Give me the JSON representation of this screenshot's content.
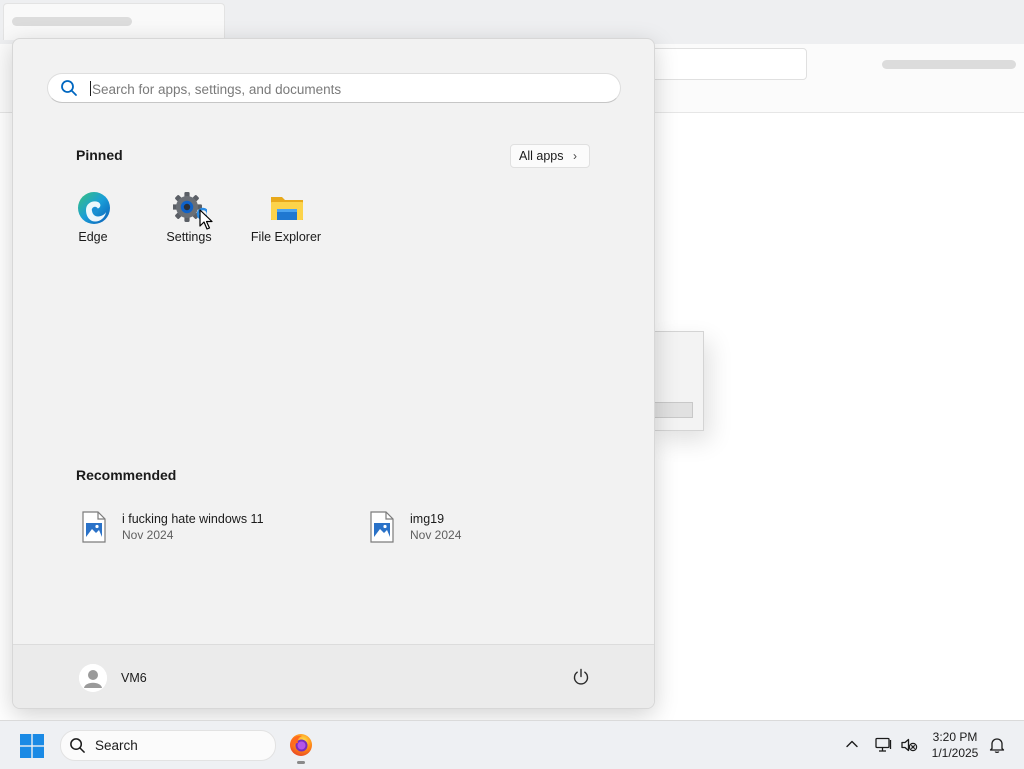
{
  "background_window": {},
  "start_menu": {
    "search": {
      "placeholder": "Search for apps, settings, and documents",
      "icon": "search-icon"
    },
    "pinned": {
      "title": "Pinned",
      "all_apps_label": "All apps",
      "apps": [
        {
          "label": "Edge",
          "icon": "edge-icon"
        },
        {
          "label": "Settings",
          "icon": "settings-gear-icon"
        },
        {
          "label": "File Explorer",
          "icon": "folder-icon"
        }
      ]
    },
    "recommended": {
      "title": "Recommended",
      "items": [
        {
          "name": "i fucking hate windows 11",
          "date": "Nov 2024",
          "icon": "image-file-icon"
        },
        {
          "name": "img19",
          "date": "Nov 2024",
          "icon": "image-file-icon"
        }
      ]
    },
    "footer": {
      "user_name": "VM6",
      "avatar_icon": "user-avatar-icon",
      "power_icon": "power-icon"
    }
  },
  "taskbar": {
    "start_icon": "windows-logo-icon",
    "search_label": "Search",
    "pinned_apps": [
      {
        "name": "Firefox",
        "icon": "firefox-icon"
      }
    ],
    "tray": {
      "icons": [
        "chevron-up-icon",
        "network-icon",
        "volume-muted-icon",
        "bell-icon"
      ],
      "time": "3:20 PM",
      "date": "1/1/2025"
    }
  },
  "colors": {
    "accent": "#0067c0",
    "start_bg": "#f2f2f2",
    "taskbar_bg": "#eef0f3"
  }
}
